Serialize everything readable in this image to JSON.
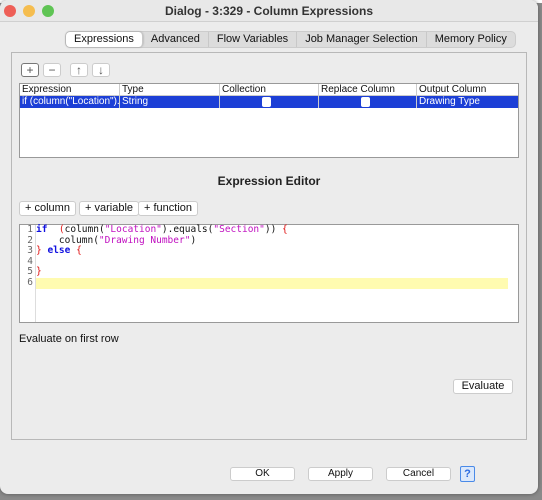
{
  "window": {
    "title": "Dialog - 3:329 - Column Expressions"
  },
  "tabs": [
    {
      "label": "Expressions",
      "active": true
    },
    {
      "label": "Advanced"
    },
    {
      "label": "Flow Variables"
    },
    {
      "label": "Job Manager Selection"
    },
    {
      "label": "Memory Policy"
    }
  ],
  "toolbar": {
    "add": "+",
    "remove": "−",
    "up": "↑",
    "down": "↓"
  },
  "table": {
    "headers": [
      "Expression",
      "Type",
      "Collection",
      "Replace Column",
      "Output Column"
    ],
    "rows": [
      {
        "expression": "if (column(\"Location\")....",
        "type": "String",
        "collection": false,
        "replace_column": false,
        "output_column": "Drawing Type",
        "selected": true
      }
    ]
  },
  "editor": {
    "title": "Expression Editor",
    "insert_buttons": [
      "+ column",
      "+ variable",
      "+ function"
    ],
    "line_numbers": [
      "1",
      "2",
      "3",
      "4",
      "5",
      "6"
    ],
    "current_line": 6
  },
  "evaluate": {
    "label": "Evaluate on first row",
    "button": "Evaluate"
  },
  "footer": {
    "ok": "OK",
    "apply": "Apply",
    "cancel": "Cancel",
    "help": "?"
  },
  "colors": {
    "selection": "#1c3fd6",
    "keyword": "#1010e0",
    "string": "#c010c0",
    "brace": "#e01010",
    "current_line": "#fffbb0"
  }
}
